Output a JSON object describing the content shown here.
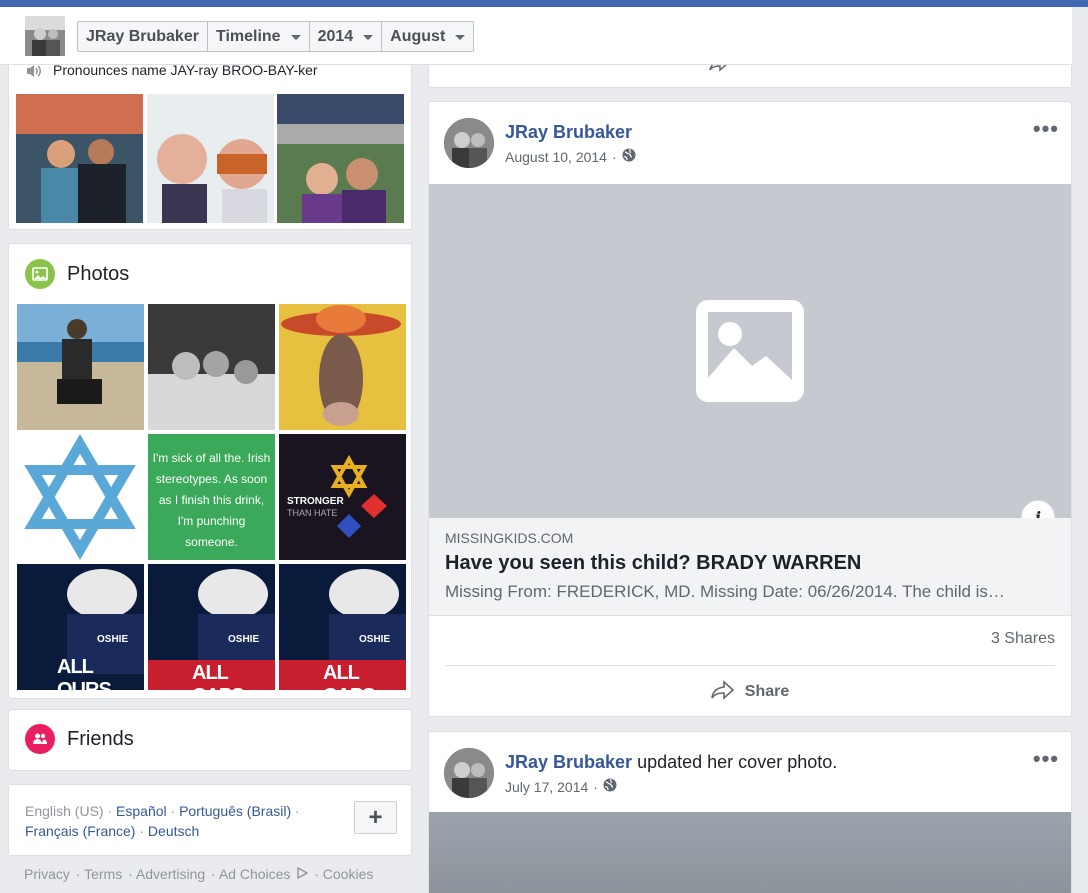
{
  "header": {
    "name": "JRay Brubaker",
    "tabs": [
      {
        "label": "Timeline"
      },
      {
        "label": "2014"
      },
      {
        "label": "August"
      }
    ]
  },
  "intro": {
    "pronounce_text": "Pronounces name JAY-ray BROO-BAY-ker"
  },
  "photos": {
    "title": "Photos",
    "grid_texts": {
      "irish": "I'm sick of all the. Irish stereotypes. As soon as I finish this drink, I'm punching someone.",
      "stronger": "STRONGER",
      "than_hate": "THAN HATE",
      "all_ours": "ALL OURS",
      "all_caps": "ALL CAPS",
      "oshie": "OSHIE"
    }
  },
  "friends": {
    "title": "Friends"
  },
  "languages": {
    "current": "English (US)",
    "links": [
      "Español",
      "Português (Brasil)",
      "Français (France)",
      "Deutsch"
    ],
    "add": "+"
  },
  "footer": {
    "links": [
      "Privacy",
      "Terms",
      "Advertising",
      "Ad Choices",
      "Cookies"
    ]
  },
  "posts": [
    {
      "author": "JRay Brubaker",
      "date": "August 10, 2014",
      "more": "•••",
      "link": {
        "domain": "MISSINGKIDS.COM",
        "title": "Have you seen this child? BRADY WARREN",
        "description": "Missing From: FREDERICK, MD. Missing Date: 06/26/2014. The child is…"
      },
      "shares": "3 Shares",
      "share_label": "Share"
    },
    {
      "author": "JRay Brubaker",
      "action": "updated her cover photo.",
      "date": "July 17, 2014",
      "more": "•••"
    }
  ],
  "colors": {
    "brand": "#4267b2",
    "link": "#365899",
    "photos_icon": "#8bc34a",
    "friends_icon": "#e91e63"
  }
}
